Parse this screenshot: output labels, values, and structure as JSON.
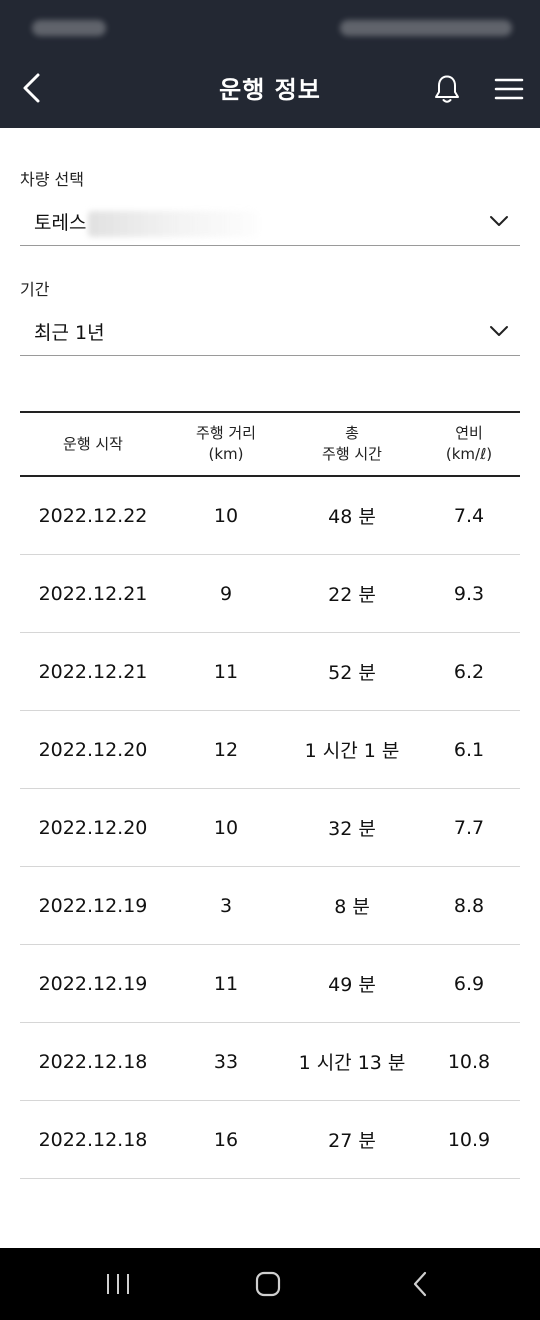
{
  "header": {
    "title": "운행 정보"
  },
  "vehicle": {
    "label": "차량 선택",
    "value": "토레스"
  },
  "period": {
    "label": "기간",
    "value": "최근 1년"
  },
  "table": {
    "headers": [
      {
        "line1": "운행 시작",
        "line2": ""
      },
      {
        "line1": "주행 거리",
        "line2": "(km)"
      },
      {
        "line1": "총",
        "line2": "주행 시간"
      },
      {
        "line1": "연비",
        "line2": "(km/ℓ)"
      }
    ],
    "rows": [
      {
        "date": "2022.12.22",
        "distance": "10",
        "duration": "48 분",
        "efficiency": "7.4"
      },
      {
        "date": "2022.12.21",
        "distance": "9",
        "duration": "22 분",
        "efficiency": "9.3"
      },
      {
        "date": "2022.12.21",
        "distance": "11",
        "duration": "52 분",
        "efficiency": "6.2"
      },
      {
        "date": "2022.12.20",
        "distance": "12",
        "duration": "1 시간 1 분",
        "efficiency": "6.1"
      },
      {
        "date": "2022.12.20",
        "distance": "10",
        "duration": "32 분",
        "efficiency": "7.7"
      },
      {
        "date": "2022.12.19",
        "distance": "3",
        "duration": "8 분",
        "efficiency": "8.8"
      },
      {
        "date": "2022.12.19",
        "distance": "11",
        "duration": "49 분",
        "efficiency": "6.9"
      },
      {
        "date": "2022.12.18",
        "distance": "33",
        "duration": "1 시간 13 분",
        "efficiency": "10.8"
      },
      {
        "date": "2022.12.18",
        "distance": "16",
        "duration": "27 분",
        "efficiency": "10.9"
      }
    ]
  },
  "icons": {
    "back": "back-arrow-icon",
    "bell": "bell-icon",
    "menu": "hamburger-menu-icon",
    "dropdown": "chevron-down-icon",
    "recents": "recent-apps-icon",
    "home": "home-icon",
    "sys_back": "system-back-icon"
  },
  "colors": {
    "header_bg": "#232833",
    "nav_bg": "#000000",
    "divider": "#d6d6d6"
  }
}
